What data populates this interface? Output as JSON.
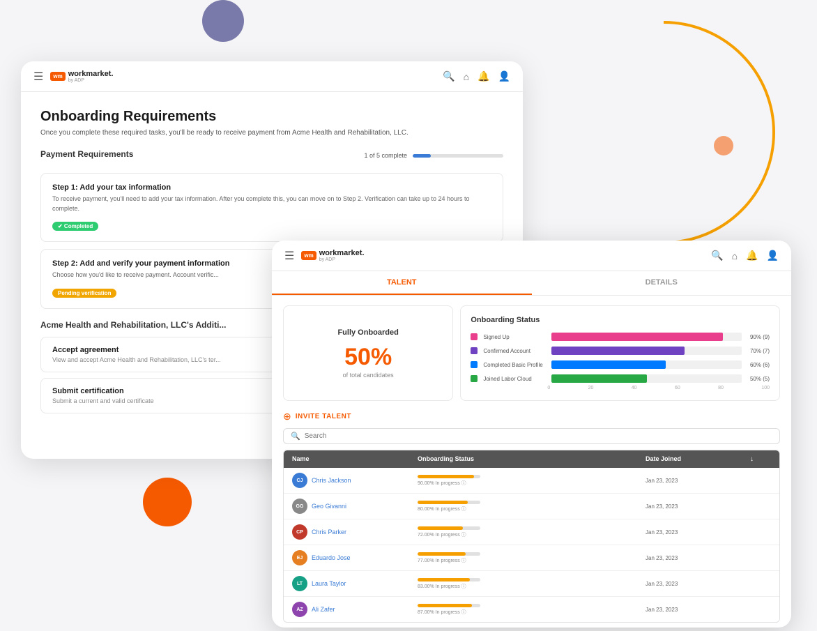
{
  "decorative": {
    "arc_color": "#f5a000"
  },
  "back_window": {
    "nav": {
      "logo_text": "workmarket.",
      "logo_sub": "by ADP",
      "logo_abbr": "wm"
    },
    "title": "Onboarding Requirements",
    "subtitle": "Once you complete these required tasks, you'll be ready to receive payment from Acme Health and Rehabilitation, LLC.",
    "payment_section_title": "Payment Requirements",
    "progress_label": "1 of 5 complete",
    "progress_pct": "20",
    "steps": [
      {
        "title": "Step 1: Add your tax information",
        "desc": "To receive payment, you'll need to add your tax information. After you complete this, you can move on to Step 2.\nVerification can take up to 24 hours to complete.",
        "badge": "completed",
        "badge_label": "✔ Completed"
      },
      {
        "title": "Step 2: Add and verify your payment information",
        "desc": "Choose how you'd like to receive payment. Account verific...",
        "badge": "pending",
        "badge_label": "Pending verification"
      }
    ],
    "additional_section_title": "Acme Health and Rehabilitation, LLC's Additi...",
    "additional_items": [
      {
        "title": "Accept agreement",
        "desc": "View and accept Acme Health and Rehabilitation, LLC's ter..."
      },
      {
        "title": "Submit certification",
        "desc": "Submit a current and valid certificate"
      }
    ]
  },
  "front_window": {
    "nav": {
      "logo_text": "workmarket.",
      "logo_sub": "by ADP",
      "logo_abbr": "wm"
    },
    "tabs": [
      {
        "label": "TALENT",
        "active": true
      },
      {
        "label": "DETAILS",
        "active": false
      }
    ],
    "chart_left": {
      "title": "Fully Onboarded",
      "percent": "50%",
      "sub": "of total candidates"
    },
    "chart_right": {
      "title": "Onboarding Status",
      "bars": [
        {
          "label": "Signed Up",
          "color": "#e83e8c",
          "pct": 90,
          "value": "90% (9)"
        },
        {
          "label": "Confirmed Account",
          "color": "#6f42c1",
          "pct": 70,
          "value": "70% (7)"
        },
        {
          "label": "Completed Basic Profile",
          "color": "#007bff",
          "pct": 60,
          "value": "60% (6)"
        },
        {
          "label": "Joined Labor Cloud",
          "color": "#28a745",
          "pct": 50,
          "value": "50% (5)"
        }
      ],
      "x_labels": [
        "0",
        "20",
        "40",
        "60",
        "80",
        "100"
      ]
    },
    "invite": {
      "label": "INVITE TALENT"
    },
    "search": {
      "placeholder": "Search"
    },
    "table": {
      "headers": [
        "Name",
        "Onboarding Status",
        "Date Joined",
        ""
      ],
      "rows": [
        {
          "initials": "CJ",
          "color": "#3a7bd5",
          "name": "Chris Jackson",
          "status_pct": 90,
          "status_text": "90.00% In progress ⓘ",
          "date": "Jan 23, 2023"
        },
        {
          "initials": "GG",
          "color": "#888",
          "name": "Geo Givanni",
          "status_pct": 80,
          "status_text": "80.00% In progress ⓘ",
          "date": "Jan 23, 2023"
        },
        {
          "initials": "CP",
          "color": "#c0392b",
          "name": "Chris Parker",
          "status_pct": 72,
          "status_text": "72.00% In progress ⓘ",
          "date": "Jan 23, 2023"
        },
        {
          "initials": "EJ",
          "color": "#e67e22",
          "name": "Eduardo Jose",
          "status_pct": 77,
          "status_text": "77.00% In progress ⓘ",
          "date": "Jan 23, 2023"
        },
        {
          "initials": "LT",
          "color": "#16a085",
          "name": "Laura Taylor",
          "status_pct": 83,
          "status_text": "83.00% In progress ⓘ",
          "date": "Jan 23, 2023"
        },
        {
          "initials": "AZ",
          "color": "#8e44ad",
          "name": "Ali Zafer",
          "status_pct": 87,
          "status_text": "87.00% In progress ⓘ",
          "date": "Jan 23, 2023"
        }
      ]
    }
  }
}
